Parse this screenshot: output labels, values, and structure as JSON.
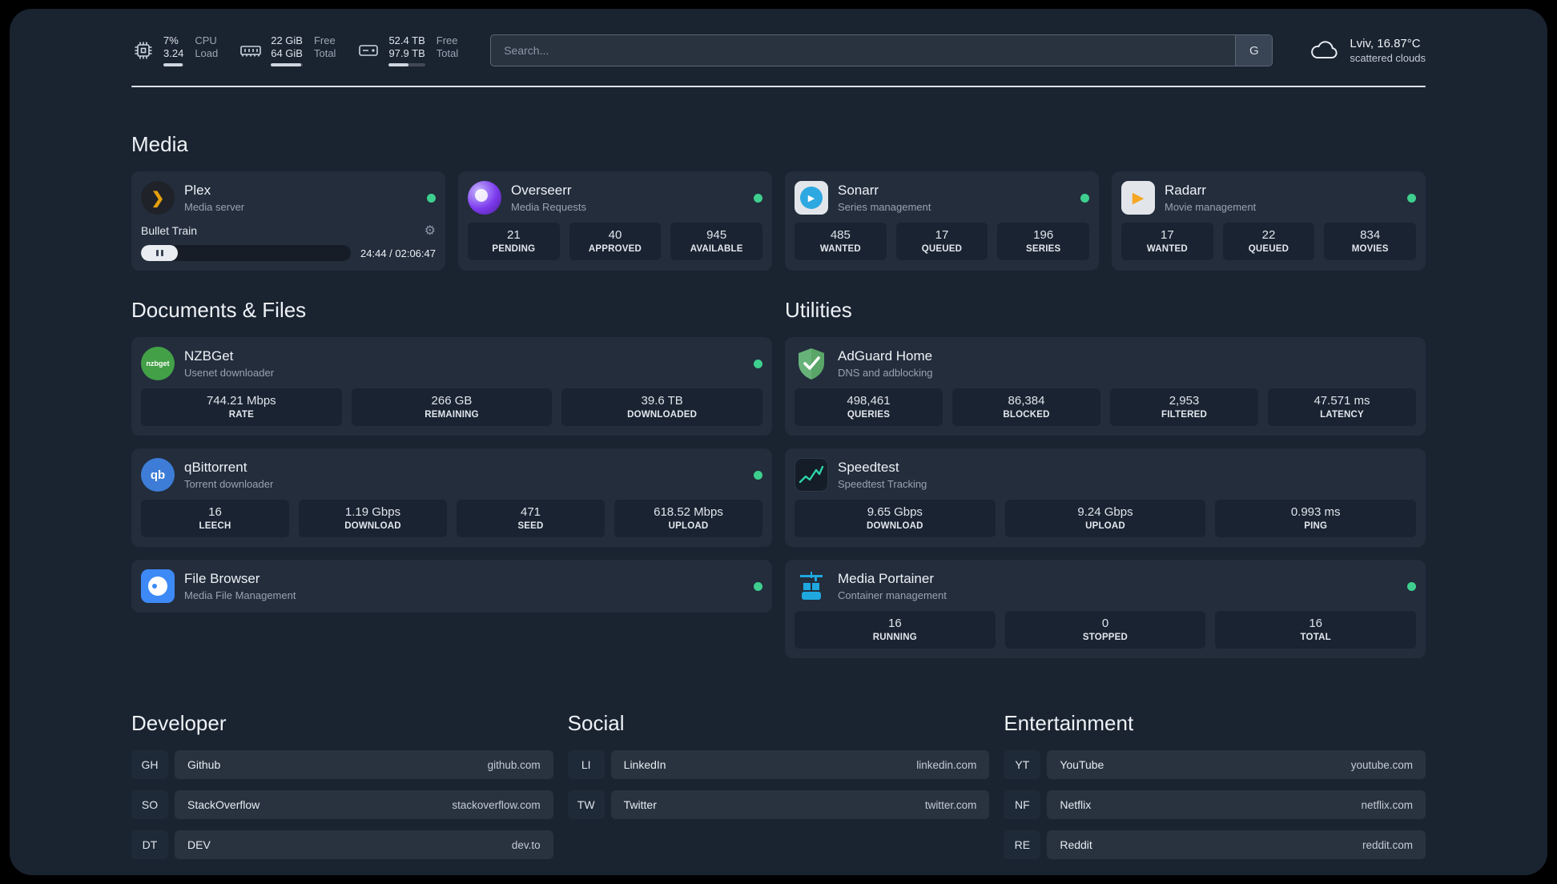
{
  "theme": {
    "background": "#1a2330",
    "card": "#232d3c",
    "tile": "#1a2331",
    "status_green": "#3ecf8e",
    "accent_amber": "#e5a00d"
  },
  "header": {
    "cpu": {
      "percent": "7%",
      "value": "3.24",
      "label_top": "CPU",
      "label_bottom": "Load",
      "bar_percent": 93
    },
    "ram": {
      "free": "22 GiB",
      "total": "64 GiB",
      "label_top": "Free",
      "label_bottom": "Total",
      "bar_percent": 95
    },
    "disk": {
      "free": "52.4 TB",
      "total": "97.9 TB",
      "label_top": "Free",
      "label_bottom": "Total",
      "bar_percent": 54
    },
    "search": {
      "placeholder": "Search...",
      "provider_button": "G"
    },
    "weather": {
      "location": "Lviv, 16.87°C",
      "condition": "scattered clouds"
    }
  },
  "icons": {
    "gear": "⚙",
    "plex_glyph": "❯",
    "play_glyph": "▶",
    "nzbget_text": "nzbget",
    "qb_text": "qb"
  },
  "media": {
    "title": "Media",
    "plex": {
      "name": "Plex",
      "desc": "Media server",
      "now_playing": "Bullet Train",
      "time": "24:44 / 02:06:47"
    },
    "overseerr": {
      "name": "Overseerr",
      "desc": "Media Requests",
      "stats": [
        {
          "value": "21",
          "label": "PENDING"
        },
        {
          "value": "40",
          "label": "APPROVED"
        },
        {
          "value": "945",
          "label": "AVAILABLE"
        }
      ]
    },
    "sonarr": {
      "name": "Sonarr",
      "desc": "Series management",
      "stats": [
        {
          "value": "485",
          "label": "WANTED"
        },
        {
          "value": "17",
          "label": "QUEUED"
        },
        {
          "value": "196",
          "label": "SERIES"
        }
      ]
    },
    "radarr": {
      "name": "Radarr",
      "desc": "Movie management",
      "stats": [
        {
          "value": "17",
          "label": "WANTED"
        },
        {
          "value": "22",
          "label": "QUEUED"
        },
        {
          "value": "834",
          "label": "MOVIES"
        }
      ]
    }
  },
  "documents": {
    "title": "Documents & Files",
    "nzbget": {
      "name": "NZBGet",
      "desc": "Usenet downloader",
      "stats": [
        {
          "value": "744.21 Mbps",
          "label": "RATE"
        },
        {
          "value": "266 GB",
          "label": "REMAINING"
        },
        {
          "value": "39.6 TB",
          "label": "DOWNLOADED"
        }
      ]
    },
    "qbittorrent": {
      "name": "qBittorrent",
      "desc": "Torrent downloader",
      "stats": [
        {
          "value": "16",
          "label": "LEECH"
        },
        {
          "value": "1.19 Gbps",
          "label": "DOWNLOAD"
        },
        {
          "value": "471",
          "label": "SEED"
        },
        {
          "value": "618.52 Mbps",
          "label": "UPLOAD"
        }
      ]
    },
    "filebrowser": {
      "name": "File Browser",
      "desc": "Media File Management"
    }
  },
  "utilities": {
    "title": "Utilities",
    "adguard": {
      "name": "AdGuard Home",
      "desc": "DNS and adblocking",
      "stats": [
        {
          "value": "498,461",
          "label": "QUERIES"
        },
        {
          "value": "86,384",
          "label": "BLOCKED"
        },
        {
          "value": "2,953",
          "label": "FILTERED"
        },
        {
          "value": "47.571 ms",
          "label": "LATENCY"
        }
      ]
    },
    "speedtest": {
      "name": "Speedtest",
      "desc": "Speedtest Tracking",
      "stats": [
        {
          "value": "9.65 Gbps",
          "label": "DOWNLOAD"
        },
        {
          "value": "9.24 Gbps",
          "label": "UPLOAD"
        },
        {
          "value": "0.993 ms",
          "label": "PING"
        }
      ]
    },
    "portainer": {
      "name": "Media Portainer",
      "desc": "Container management",
      "stats": [
        {
          "value": "16",
          "label": "RUNNING"
        },
        {
          "value": "0",
          "label": "STOPPED"
        },
        {
          "value": "16",
          "label": "TOTAL"
        }
      ]
    }
  },
  "bookmarks": {
    "developer": {
      "title": "Developer",
      "items": [
        {
          "abbr": "GH",
          "name": "Github",
          "url": "github.com"
        },
        {
          "abbr": "SO",
          "name": "StackOverflow",
          "url": "stackoverflow.com"
        },
        {
          "abbr": "DT",
          "name": "DEV",
          "url": "dev.to"
        }
      ]
    },
    "social": {
      "title": "Social",
      "items": [
        {
          "abbr": "LI",
          "name": "LinkedIn",
          "url": "linkedin.com"
        },
        {
          "abbr": "TW",
          "name": "Twitter",
          "url": "twitter.com"
        }
      ]
    },
    "entertainment": {
      "title": "Entertainment",
      "items": [
        {
          "abbr": "YT",
          "name": "YouTube",
          "url": "youtube.com"
        },
        {
          "abbr": "NF",
          "name": "Netflix",
          "url": "netflix.com"
        },
        {
          "abbr": "RE",
          "name": "Reddit",
          "url": "reddit.com"
        }
      ]
    }
  }
}
